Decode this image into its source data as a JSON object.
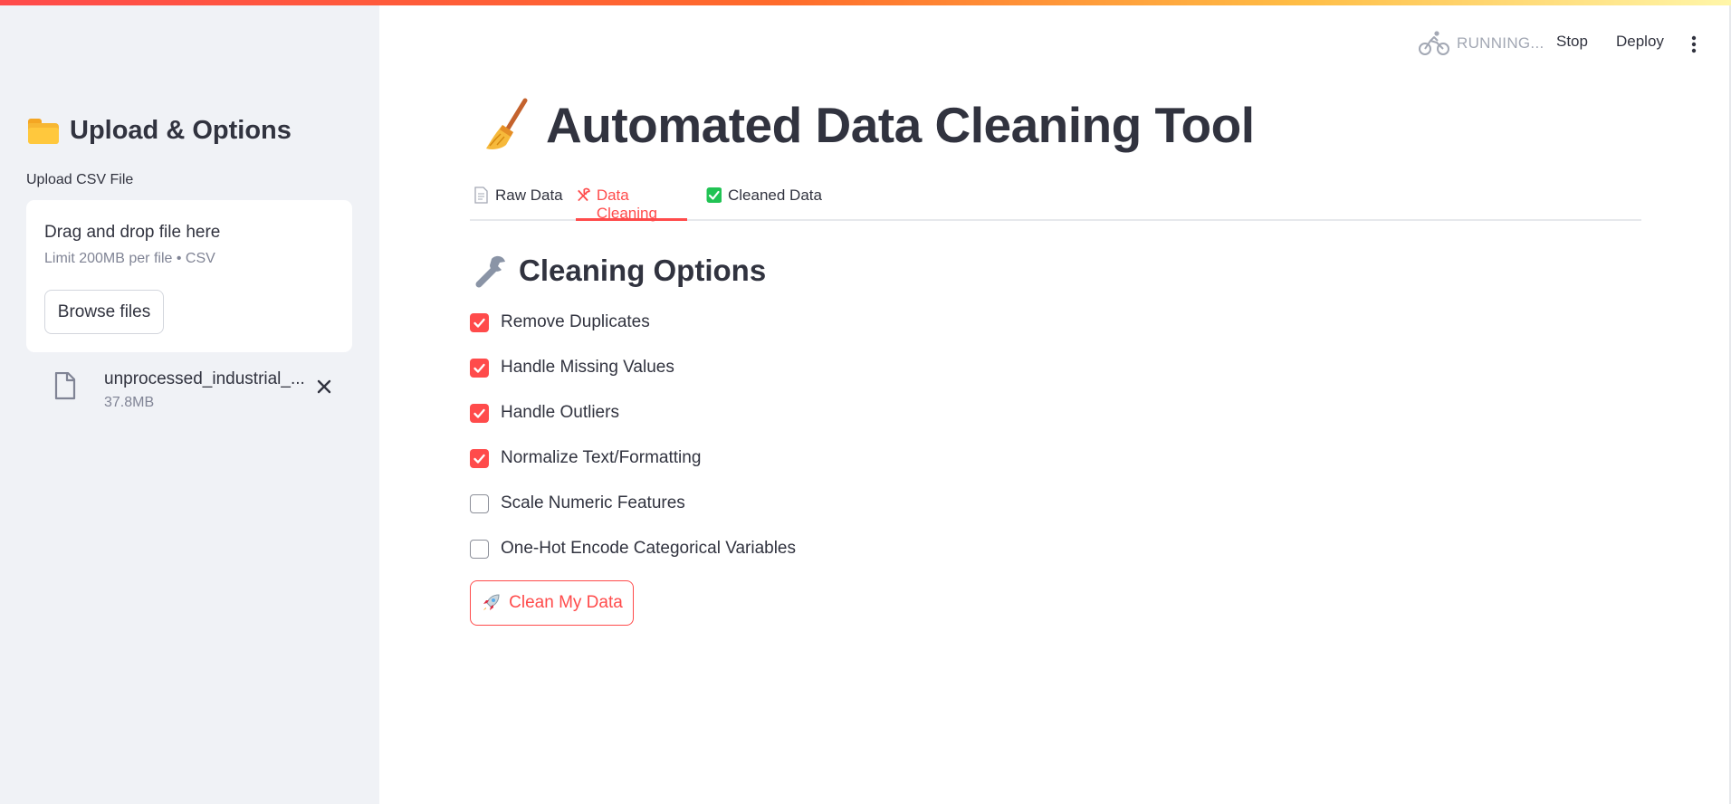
{
  "header": {
    "status_text": "RUNNING...",
    "stop_label": "Stop",
    "deploy_label": "Deploy"
  },
  "sidebar": {
    "title": "Upload & Options",
    "upload_label": "Upload CSV File",
    "dropzone": {
      "title": "Drag and drop file here",
      "subtitle": "Limit 200MB per file • CSV",
      "browse_label": "Browse files"
    },
    "file": {
      "name": "unprocessed_industrial_...",
      "size": "37.8MB"
    }
  },
  "main": {
    "title": "Automated Data Cleaning Tool",
    "tabs": [
      {
        "label": "Raw Data",
        "active": false
      },
      {
        "label": "Data Cleaning",
        "active": true
      },
      {
        "label": "Cleaned Data",
        "active": false
      }
    ],
    "section_title": "Cleaning Options",
    "options": [
      {
        "label": "Remove Duplicates",
        "checked": true
      },
      {
        "label": "Handle Missing Values",
        "checked": true
      },
      {
        "label": "Handle Outliers",
        "checked": true
      },
      {
        "label": "Normalize Text/Formatting",
        "checked": true
      },
      {
        "label": "Scale Numeric Features",
        "checked": false
      },
      {
        "label": "One-Hot Encode Categorical Variables",
        "checked": false
      }
    ],
    "action_label": "Clean My Data"
  },
  "colors": {
    "accent": "#ff4b4b",
    "sidebar_bg": "#f0f2f6",
    "text": "#31333f",
    "muted": "#808495",
    "check_green": "#21c354"
  }
}
